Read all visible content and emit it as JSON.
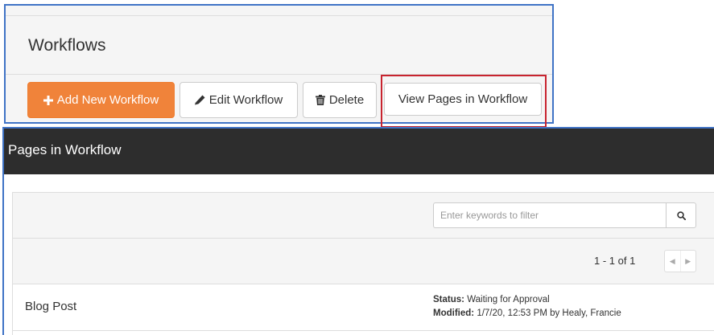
{
  "workflows": {
    "title": "Workflows",
    "buttons": {
      "add": "Add New Workflow",
      "edit": "Edit Workflow",
      "delete": "Delete",
      "view": "View Pages in Workflow"
    }
  },
  "pages_panel": {
    "title": "Pages in Workflow",
    "filter_placeholder": "Enter keywords to filter",
    "pager_text": "1 - 1 of 1",
    "rows": [
      {
        "name": "Blog Post",
        "status_label": "Status:",
        "status": "Waiting for Approval",
        "modified_label": "Modified:",
        "modified": "1/7/20, 12:53 PM by Healy, Francie"
      }
    ]
  },
  "colors": {
    "accent_orange": "#f0833a",
    "panel_border_blue": "#3f73c6",
    "highlight_red": "#c8242f",
    "dark_header": "#2d2d2d"
  },
  "icons": {
    "add": "plus-icon",
    "edit": "pencil-icon",
    "delete": "trash-icon",
    "search": "search-icon",
    "pager_prev": "chevron-left-icon",
    "pager_next": "chevron-right-icon"
  }
}
